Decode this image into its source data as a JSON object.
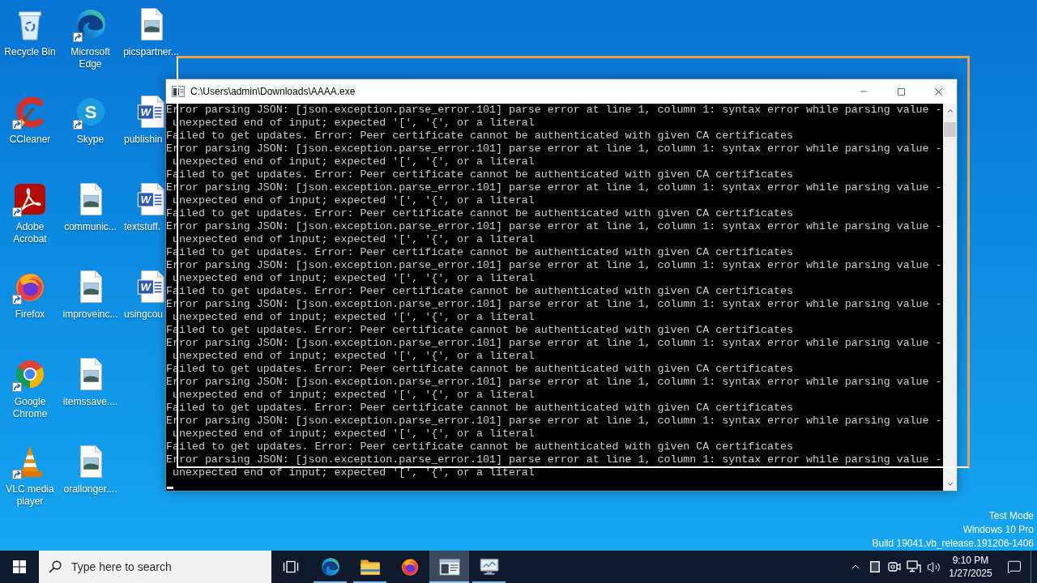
{
  "desktop_icons": [
    {
      "label": "Recycle Bin",
      "shortcut": false,
      "clipped": false
    },
    {
      "label": "CCleaner",
      "shortcut": true,
      "clipped": false
    },
    {
      "label": "Adobe Acrobat",
      "shortcut": true,
      "clipped": false
    },
    {
      "label": "Firefox",
      "shortcut": true,
      "clipped": false
    },
    {
      "label": "Google Chrome",
      "shortcut": true,
      "clipped": false
    },
    {
      "label": "VLC media player",
      "shortcut": true,
      "clipped": false
    },
    {
      "label": "Microsoft Edge",
      "shortcut": true,
      "clipped": false
    },
    {
      "label": "Skype",
      "shortcut": true,
      "clipped": false,
      "logo_text": "S"
    },
    {
      "label": "communic...",
      "shortcut": false,
      "clipped": false
    },
    {
      "label": "improveinc...",
      "shortcut": false,
      "clipped": false
    },
    {
      "label": "itemssave....",
      "shortcut": false,
      "clipped": false
    },
    {
      "label": "orallonger....",
      "shortcut": false,
      "clipped": false
    },
    {
      "label": "picspartner...",
      "shortcut": false,
      "clipped": false
    },
    {
      "label": "publishin",
      "shortcut": false,
      "clipped": true,
      "logo_text": "W"
    },
    {
      "label": "textstuff.",
      "shortcut": false,
      "clipped": true,
      "logo_text": "W"
    },
    {
      "label": "usingcou",
      "shortcut": false,
      "clipped": true,
      "logo_text": "W"
    }
  ],
  "console_window": {
    "title": "C:\\Users\\admin\\Downloads\\AAAA.exe",
    "lines": [
      "Error parsing JSON: [json.exception.parse_error.101] parse error at line 1, column 1: syntax error while parsing value -",
      " unexpected end of input; expected '[', '{', or a literal",
      "Failed to get updates. Error: Peer certificate cannot be authenticated with given CA certificates",
      "Error parsing JSON: [json.exception.parse_error.101] parse error at line 1, column 1: syntax error while parsing value -",
      " unexpected end of input; expected '[', '{', or a literal",
      "Failed to get updates. Error: Peer certificate cannot be authenticated with given CA certificates",
      "Error parsing JSON: [json.exception.parse_error.101] parse error at line 1, column 1: syntax error while parsing value -",
      " unexpected end of input; expected '[', '{', or a literal",
      "Failed to get updates. Error: Peer certificate cannot be authenticated with given CA certificates",
      "Error parsing JSON: [json.exception.parse_error.101] parse error at line 1, column 1: syntax error while parsing value -",
      " unexpected end of input; expected '[', '{', or a literal",
      "Failed to get updates. Error: Peer certificate cannot be authenticated with given CA certificates",
      "Error parsing JSON: [json.exception.parse_error.101] parse error at line 1, column 1: syntax error while parsing value -",
      " unexpected end of input; expected '[', '{', or a literal",
      "Failed to get updates. Error: Peer certificate cannot be authenticated with given CA certificates",
      "Error parsing JSON: [json.exception.parse_error.101] parse error at line 1, column 1: syntax error while parsing value -",
      " unexpected end of input; expected '[', '{', or a literal",
      "Failed to get updates. Error: Peer certificate cannot be authenticated with given CA certificates",
      "Error parsing JSON: [json.exception.parse_error.101] parse error at line 1, column 1: syntax error while parsing value -",
      " unexpected end of input; expected '[', '{', or a literal",
      "Failed to get updates. Error: Peer certificate cannot be authenticated with given CA certificates",
      "Error parsing JSON: [json.exception.parse_error.101] parse error at line 1, column 1: syntax error while parsing value -",
      " unexpected end of input; expected '[', '{', or a literal",
      "Failed to get updates. Error: Peer certificate cannot be authenticated with given CA certificates",
      "Error parsing JSON: [json.exception.parse_error.101] parse error at line 1, column 1: syntax error while parsing value -",
      " unexpected end of input; expected '[', '{', or a literal",
      "Failed to get updates. Error: Peer certificate cannot be authenticated with given CA certificates",
      "Error parsing JSON: [json.exception.parse_error.101] parse error at line 1, column 1: syntax error while parsing value -",
      " unexpected end of input; expected '[', '{', or a literal"
    ]
  },
  "system_watermark": [
    "Test Mode",
    "Windows 10 Pro",
    "Build 19041.vb_release.191206-1406"
  ],
  "taskbar": {
    "search": {
      "placeholder": "Type here to search"
    },
    "apps": [
      {
        "running": true,
        "selected": false
      },
      {
        "running": true,
        "selected": false
      },
      {
        "running": false,
        "selected": false
      },
      {
        "running": true,
        "selected": true
      },
      {
        "running": true,
        "selected": false
      }
    ],
    "clock": {
      "time": "9:10 PM",
      "date": "1/27/2025"
    }
  }
}
